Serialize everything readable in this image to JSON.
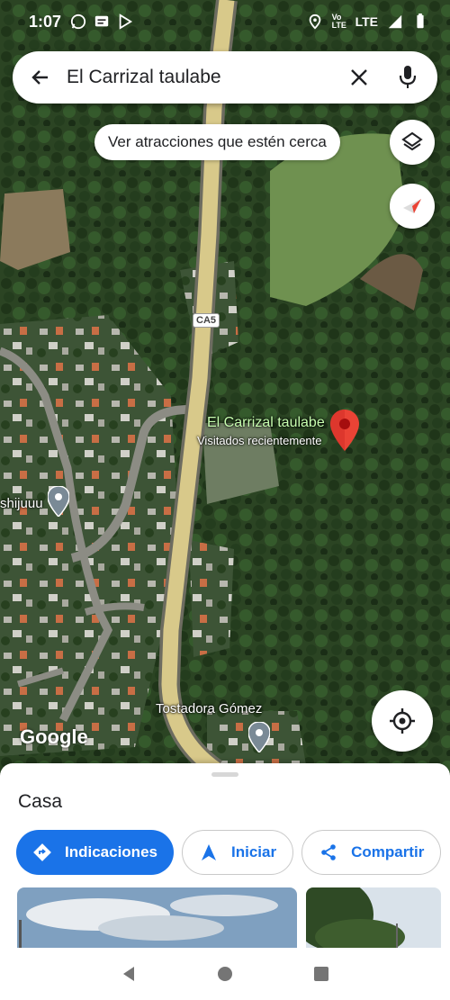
{
  "status_bar": {
    "time": "1:07",
    "network": "LTE",
    "volte": "Vo LTE",
    "icons": [
      "whatsapp-icon",
      "message-icon",
      "play-store-icon",
      "location-icon",
      "signal-icon",
      "battery-icon"
    ]
  },
  "search": {
    "query": "El Carrizal taulabe"
  },
  "chip": {
    "label": "Ver atracciones que estén cerca"
  },
  "map": {
    "road_label": "CA5",
    "pin": {
      "title": "El Carrizal taulabe",
      "subtitle": "Visitados recientemente"
    },
    "places": [
      {
        "name": "shijuuu"
      },
      {
        "name": "Tostadora Gómez"
      }
    ],
    "brand": "Google"
  },
  "sheet": {
    "title": "Casa",
    "actions": {
      "directions": "Indicaciones",
      "start": "Iniciar",
      "share": "Compartir"
    }
  },
  "colors": {
    "accent": "#1a73e8",
    "pin": "#ea4335",
    "road": "#d8c98a"
  }
}
